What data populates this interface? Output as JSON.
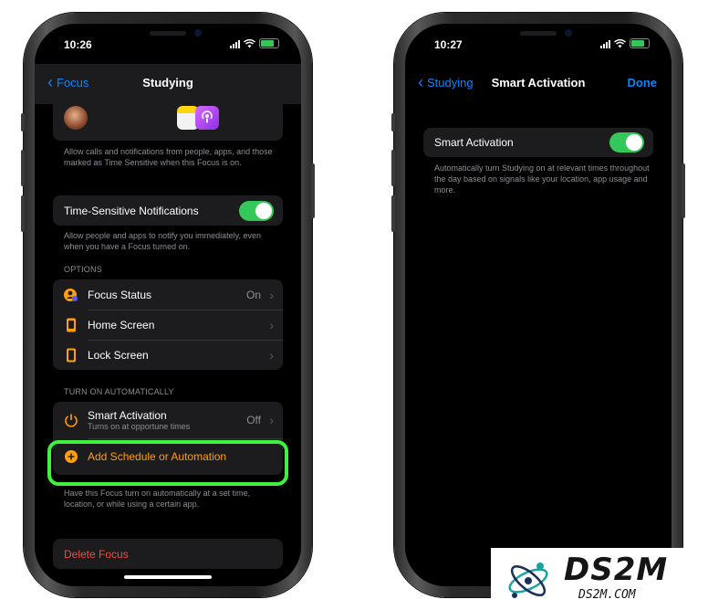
{
  "left_phone": {
    "time": "10:26",
    "nav": {
      "back_label": "Focus",
      "title": "Studying"
    },
    "allow_note": "Allow calls and notifications from people, apps, and those marked as Time Sensitive when this Focus is on.",
    "time_sensitive": {
      "label": "Time-Sensitive Notifications",
      "enabled": true,
      "note": "Allow people and apps to notify you immediately, even when you have a Focus turned on."
    },
    "options_header": "OPTIONS",
    "options": [
      {
        "label": "Focus Status",
        "value": "On",
        "icon": "focus-status-icon"
      },
      {
        "label": "Home Screen",
        "value": "",
        "icon": "home-screen-icon"
      },
      {
        "label": "Lock Screen",
        "value": "",
        "icon": "lock-screen-icon"
      }
    ],
    "auto_header": "TURN ON AUTOMATICALLY",
    "smart_activation": {
      "label": "Smart Activation",
      "sublabel": "Turns on at opportune times",
      "value": "Off"
    },
    "add_schedule": {
      "label": "Add Schedule or Automation"
    },
    "schedule_note": "Have this Focus turn on automatically at a set time, location, or while using a certain app.",
    "delete_label": "Delete Focus"
  },
  "right_phone": {
    "time": "10:27",
    "nav": {
      "back_label": "Studying",
      "title": "Smart Activation",
      "done_label": "Done"
    },
    "smart_activation": {
      "label": "Smart Activation",
      "enabled": true,
      "note": "Automatically turn Studying on at relevant times throughout the day based on signals like your location, app usage and more."
    }
  },
  "watermark": {
    "logo_text": "DS2M",
    "url": "DS2M.COM"
  },
  "colors": {
    "accent": "#0a84ff",
    "toggle_on": "#34c759",
    "highlight": "#3ef23e",
    "orange": "#ff9f0a",
    "destructive": "#ff453a"
  }
}
